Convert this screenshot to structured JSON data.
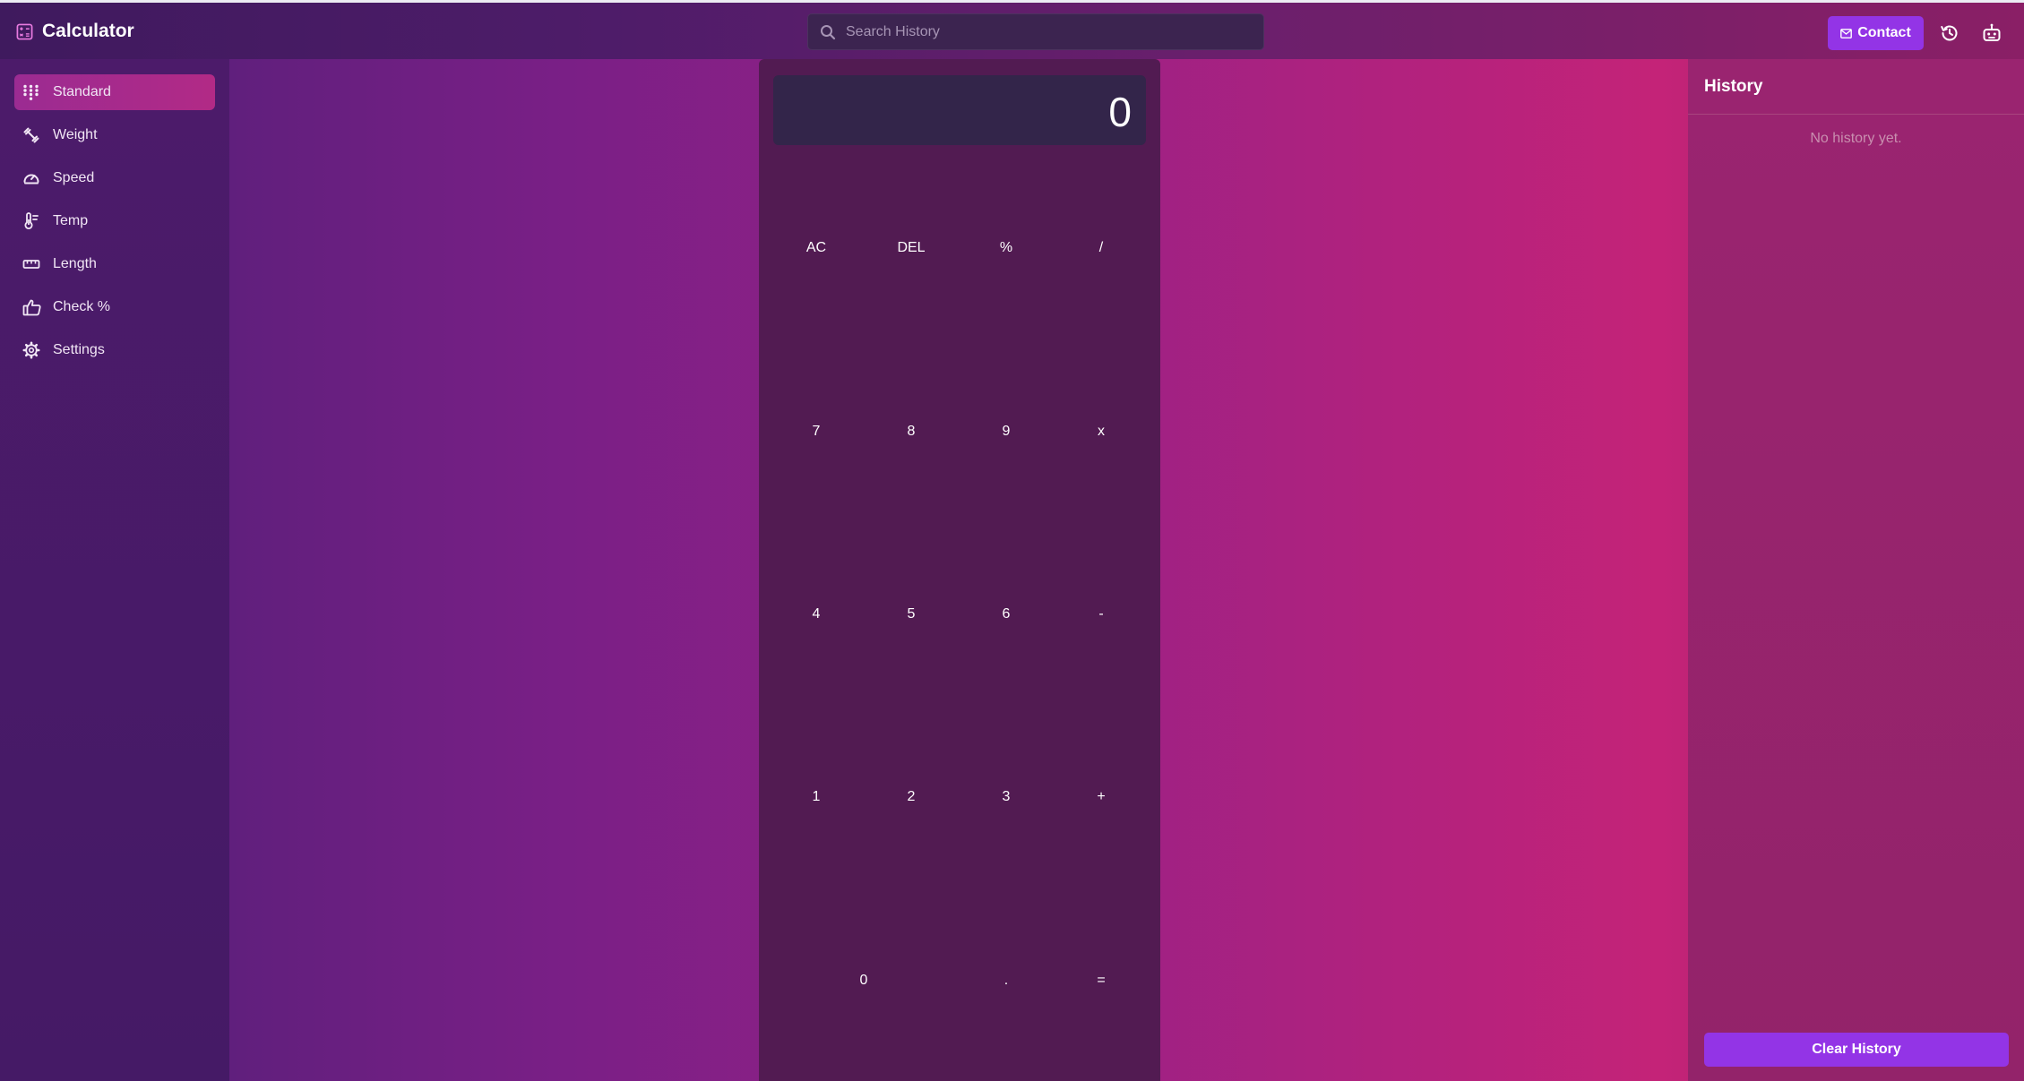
{
  "app": {
    "title": "Calculator",
    "brand_icon": "calculator-icon"
  },
  "header": {
    "search_placeholder": "Search History",
    "search_icon": "search-icon",
    "contact_label": "Contact",
    "contact_icon": "mail-icon",
    "history_icon": "history-icon",
    "robot_icon": "robot-icon",
    "accent_color": "#9334e6"
  },
  "sidebar": {
    "items": [
      {
        "label": "Standard",
        "icon": "keypad-icon",
        "active": true
      },
      {
        "label": "Weight",
        "icon": "weight-icon",
        "active": false
      },
      {
        "label": "Speed",
        "icon": "speedometer-icon",
        "active": false
      },
      {
        "label": "Temp",
        "icon": "thermometer-icon",
        "active": false
      },
      {
        "label": "Length",
        "icon": "ruler-icon",
        "active": false
      },
      {
        "label": "Check %",
        "icon": "thumbs-up-icon",
        "active": false
      },
      {
        "label": "Settings",
        "icon": "gear-icon",
        "active": false
      }
    ]
  },
  "calculator": {
    "display": "0",
    "keys": {
      "ac": "AC",
      "del": "DEL",
      "percent": "%",
      "divide": "/",
      "k7": "7",
      "k8": "8",
      "k9": "9",
      "multiply": "x",
      "k4": "4",
      "k5": "5",
      "k6": "6",
      "minus": "-",
      "k1": "1",
      "k2": "2",
      "k3": "3",
      "plus": "+",
      "k0": "0",
      "dot": ".",
      "equals": "="
    }
  },
  "history": {
    "title": "History",
    "empty_text": "No history yet.",
    "clear_label": "Clear History"
  }
}
